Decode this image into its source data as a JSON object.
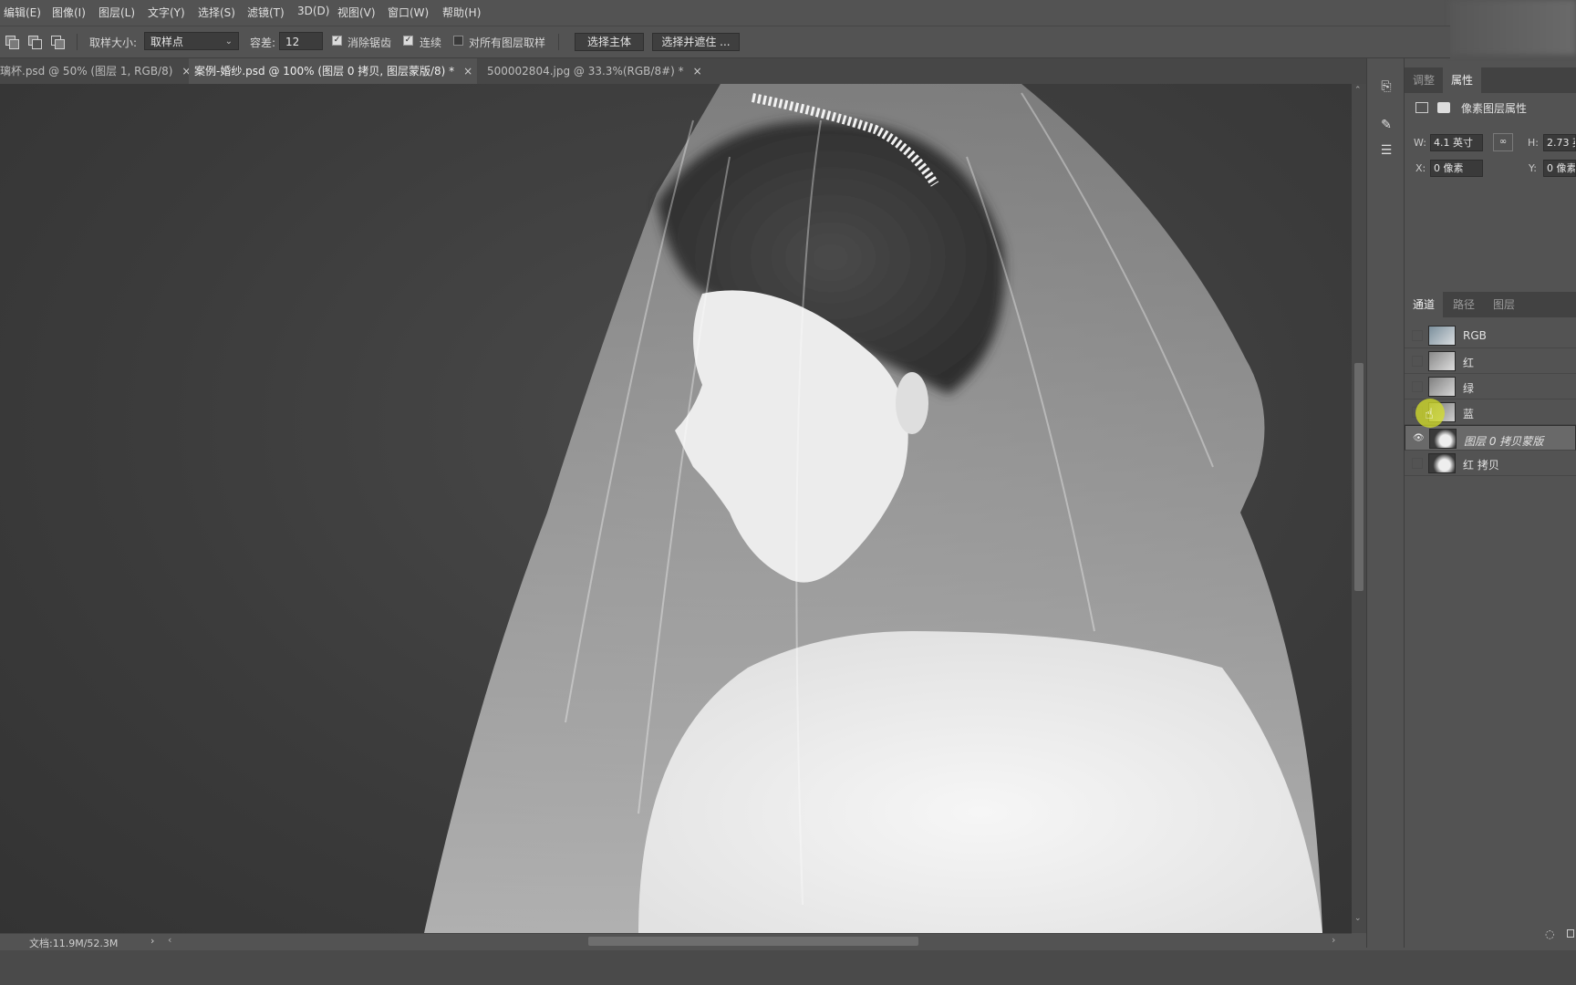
{
  "menu": [
    "编辑(E)",
    "图像(I)",
    "图层(L)",
    "文字(Y)",
    "选择(S)",
    "滤镜(T)",
    "3D(D)",
    "视图(V)",
    "窗口(W)",
    "帮助(H)"
  ],
  "options": {
    "sample_size_label": "取样大小:",
    "sample_size_value": "取样点",
    "tolerance_label": "容差:",
    "tolerance_value": "12",
    "antialias_label": "消除锯齿",
    "contiguous_label": "连续",
    "all_layers_label": "对所有图层取样",
    "select_subject": "选择主体",
    "select_mask": "选择并遮住 ..."
  },
  "tabs": [
    {
      "label": "璃杯.psd @ 50% (图层 1, RGB/8)",
      "close": "×"
    },
    {
      "label": "案例-婚纱.psd @ 100% (图层 0 拷贝, 图层蒙版/8) *",
      "close": "×"
    },
    {
      "label": "500002804.jpg @ 33.3%(RGB/8#) *",
      "close": "×"
    }
  ],
  "status": {
    "doc": "文档:11.9M/52.3M"
  },
  "properties": {
    "tabs": [
      "调整",
      "属性"
    ],
    "title": "像素图层属性",
    "w_label": "W:",
    "w_value": "4.1 英寸",
    "h_label": "H:",
    "h_value": "2.73 英",
    "x_label": "X:",
    "x_value": "0 像素",
    "y_label": "Y:",
    "y_value": "0 像素",
    "link_icon": "link-icon"
  },
  "channels": {
    "tabs": [
      "通道",
      "路径",
      "图层"
    ],
    "rows": [
      {
        "label": "RGB",
        "visible": false
      },
      {
        "label": "红",
        "visible": false
      },
      {
        "label": "绿",
        "visible": false
      },
      {
        "label": "蓝",
        "visible": false
      },
      {
        "label": "图层 0 拷贝蒙版",
        "visible": true
      },
      {
        "label": "红 拷贝",
        "visible": false
      }
    ]
  }
}
